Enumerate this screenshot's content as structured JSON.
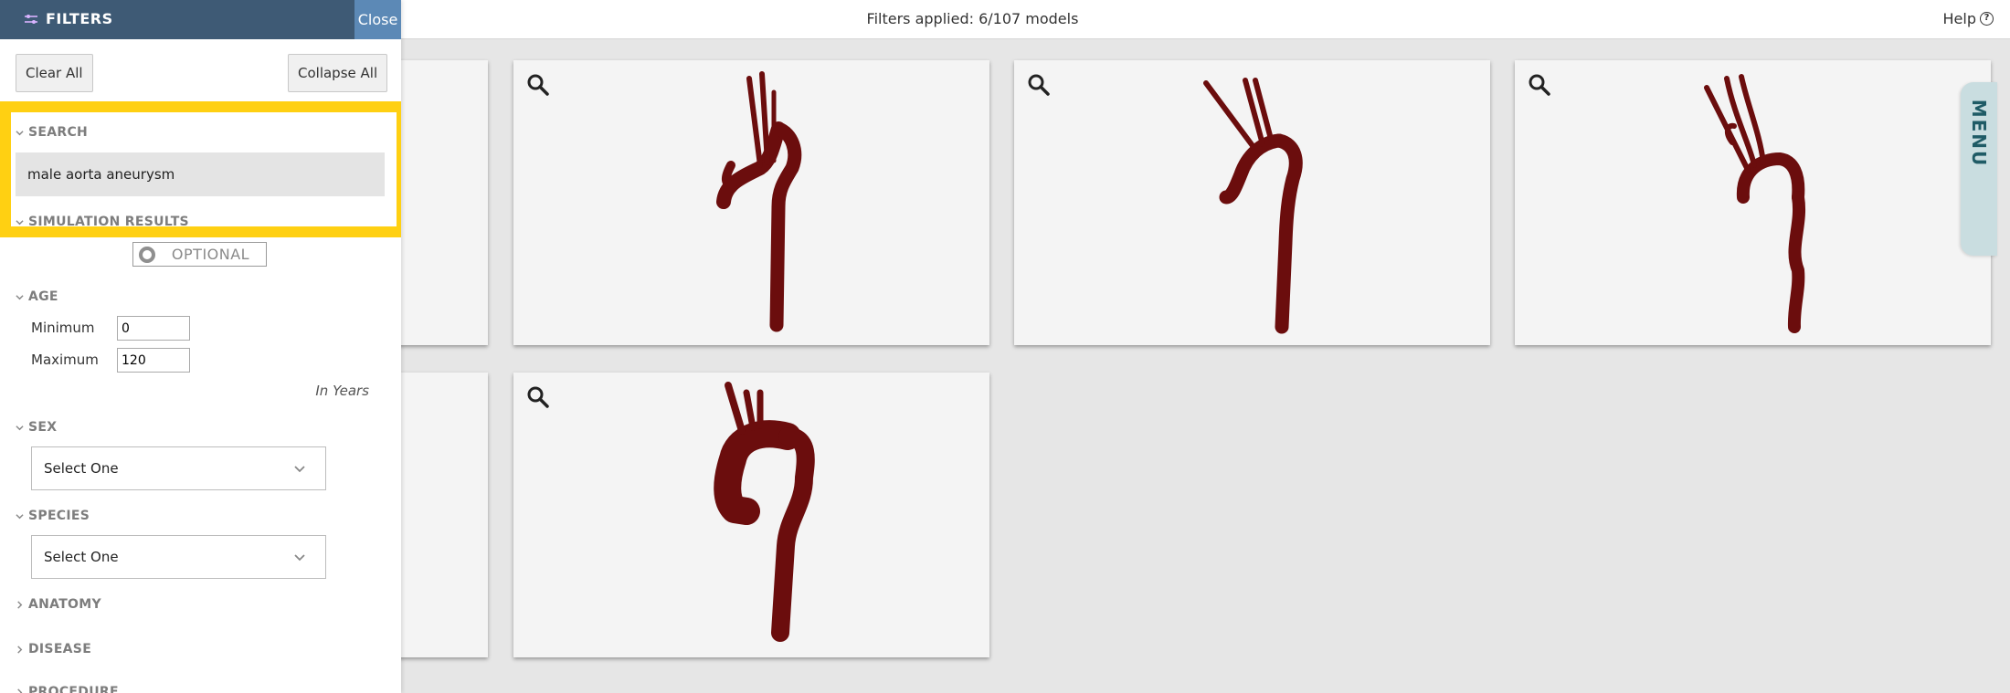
{
  "topbar": {
    "status": "Filters applied: 6/107 models",
    "help_label": "Help",
    "help_icon": "question-circle-icon"
  },
  "menu_tab": {
    "label": "MENU"
  },
  "sidebar": {
    "title": "FILTERS",
    "close_label": "Close",
    "clear_all_label": "Clear All",
    "collapse_all_label": "Collapse All",
    "sections": {
      "search": {
        "label": "SEARCH",
        "value": "male aorta aneurysm"
      },
      "simulation": {
        "label": "SIMULATION RESULTS",
        "toggle_label": "OPTIONAL"
      },
      "age": {
        "label": "AGE",
        "min_label": "Minimum",
        "min_value": "0",
        "max_label": "Maximum",
        "max_value": "120",
        "unit": "In Years"
      },
      "sex": {
        "label": "SEX",
        "selected": "Select One"
      },
      "species": {
        "label": "SPECIES",
        "selected": "Select One"
      },
      "anatomy": {
        "label": "ANATOMY"
      },
      "disease": {
        "label": "DISEASE"
      },
      "procedure": {
        "label": "PROCEDURE"
      }
    }
  },
  "colors": {
    "header": "#3e5a75",
    "close_button": "#5c89b6",
    "highlight": "#ffd012",
    "aorta": "#6b0d0d",
    "menu_tab": "#c9dde0"
  }
}
